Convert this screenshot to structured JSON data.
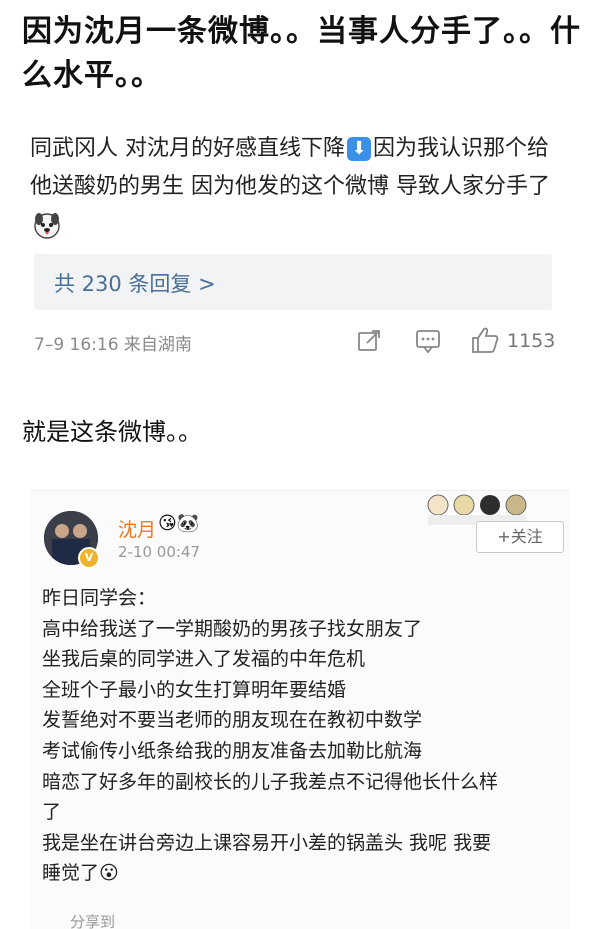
{
  "headline": "因为沈月一条微博。。当事人分手了。。什么水平。。",
  "comment": {
    "text_before_icon": "同武冈人 对沈月的好感直线下降",
    "down_arrow_glyph": "⬇",
    "text_after_icon": "因为我认识那个给他送酸奶的男生 因为他发的这个微博 导致人家分手了",
    "replies_label": "共 230 条回复 >",
    "time_source": "7–9 16:16  来自湖南",
    "like_count": "1153"
  },
  "caption": "就是这条微博。。",
  "weibo_post": {
    "username": "沈月",
    "name_emojis": "😘🐼",
    "date": "2-10 00:47",
    "follow_label": "+关注",
    "lines": [
      "昨日同学会：",
      "高中给我送了一学期酸奶的男孩子找女朋友了",
      "坐我后桌的同学进入了发福的中年危机",
      "全班个子最小的女生打算明年要结婚",
      "发誓绝对不要当老师的朋友现在在教初中数学",
      "考试偷传小纸条给我的朋友准备去加勒比航海",
      "暗恋了好多年的副校长的儿子我差点不记得他长什么样",
      "了",
      "我是坐在讲台旁边上课容易开小差的锅盖头 我呢 我要",
      "睡觉了😮"
    ],
    "actions_partial": "分享到"
  }
}
